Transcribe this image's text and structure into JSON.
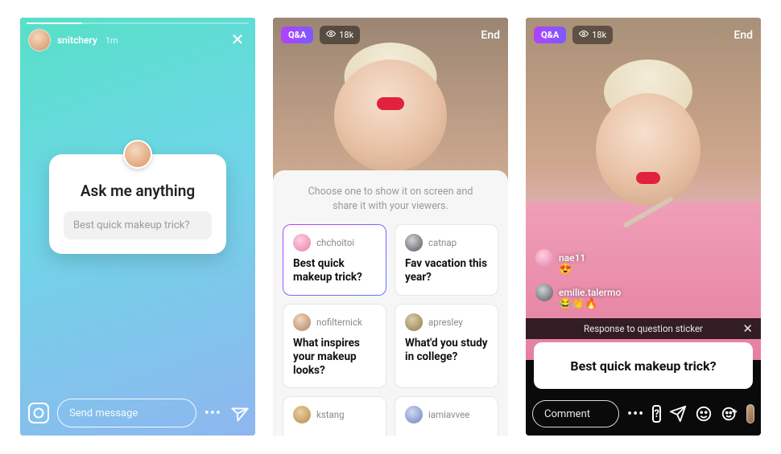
{
  "screen1": {
    "header": {
      "username": "snitchery",
      "time": "1m"
    },
    "sticker": {
      "title": "Ask me anything",
      "placeholder": "Best quick makeup trick?"
    },
    "footer": {
      "message_placeholder": "Send message"
    }
  },
  "screen2": {
    "top": {
      "qa_label": "Q&A",
      "viewer_count": "18k",
      "end_label": "End"
    },
    "sheet_hint": "Choose one to show it on screen and share it with your viewers.",
    "questions": [
      {
        "username": "chchoitoi",
        "text": "Best quick makeup trick?",
        "selected": true,
        "avatar_class": "av-1"
      },
      {
        "username": "catnap",
        "text": "Fav vacation this year?",
        "selected": false,
        "avatar_class": "av-2"
      },
      {
        "username": "nofilternick",
        "text": "What inspires your makeup looks?",
        "selected": false,
        "avatar_class": "av-3"
      },
      {
        "username": "apresley",
        "text": "What'd you study in college?",
        "selected": false,
        "avatar_class": "av-4"
      },
      {
        "username": "kstang",
        "text": "",
        "selected": false,
        "avatar_class": "av-5"
      },
      {
        "username": "iamiavvee",
        "text": "",
        "selected": false,
        "avatar_class": "av-6"
      }
    ]
  },
  "screen3": {
    "top": {
      "qa_label": "Q&A",
      "viewer_count": "18k",
      "end_label": "End"
    },
    "comments": [
      {
        "username": "nae11",
        "emojis": "😍"
      },
      {
        "username": "emilie.talermo",
        "emojis": "😂👏🔥"
      }
    ],
    "banner": {
      "header": "Response to question sticker",
      "question": "Best quick makeup trick?"
    },
    "footer": {
      "comment_placeholder": "Comment"
    }
  }
}
